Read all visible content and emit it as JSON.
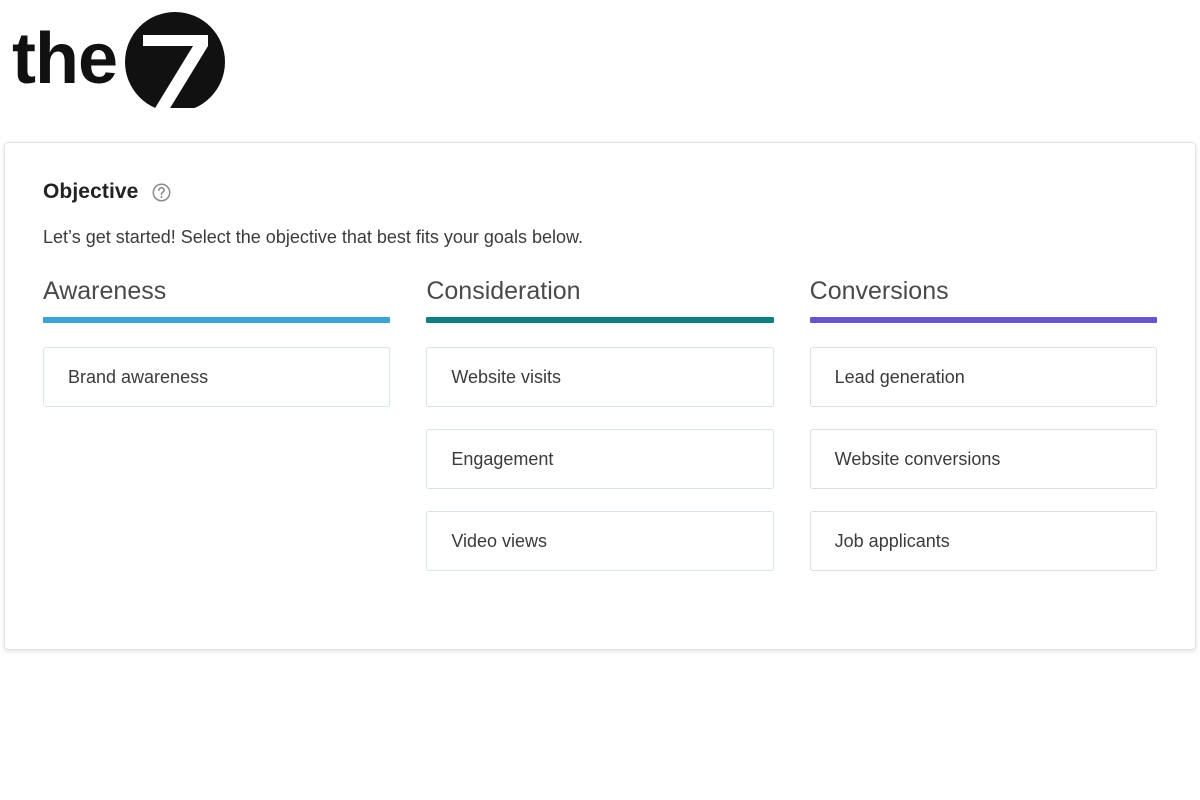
{
  "logo": {
    "word": "the",
    "numeral": "7",
    "alt": "the7-logo"
  },
  "panel": {
    "title": "Objective",
    "help_icon": "help-circle-icon",
    "subtitle": "Let’s get started! Select the objective that best fits your goals below.",
    "columns": [
      {
        "id": "awareness",
        "title": "Awareness",
        "accent": "#3AA3D4",
        "border": "#d2e8f3",
        "options": [
          {
            "label": "Brand awareness"
          }
        ]
      },
      {
        "id": "consideration",
        "title": "Consideration",
        "accent": "#0E8080",
        "border": "#d5e6e6",
        "options": [
          {
            "label": "Website visits"
          },
          {
            "label": "Engagement"
          },
          {
            "label": "Video views"
          }
        ]
      },
      {
        "id": "conversions",
        "title": "Conversions",
        "accent": "#6655CC",
        "border": "#dedcee",
        "options": [
          {
            "label": "Lead generation"
          },
          {
            "label": "Website conversions"
          },
          {
            "label": "Job applicants"
          }
        ]
      }
    ]
  }
}
